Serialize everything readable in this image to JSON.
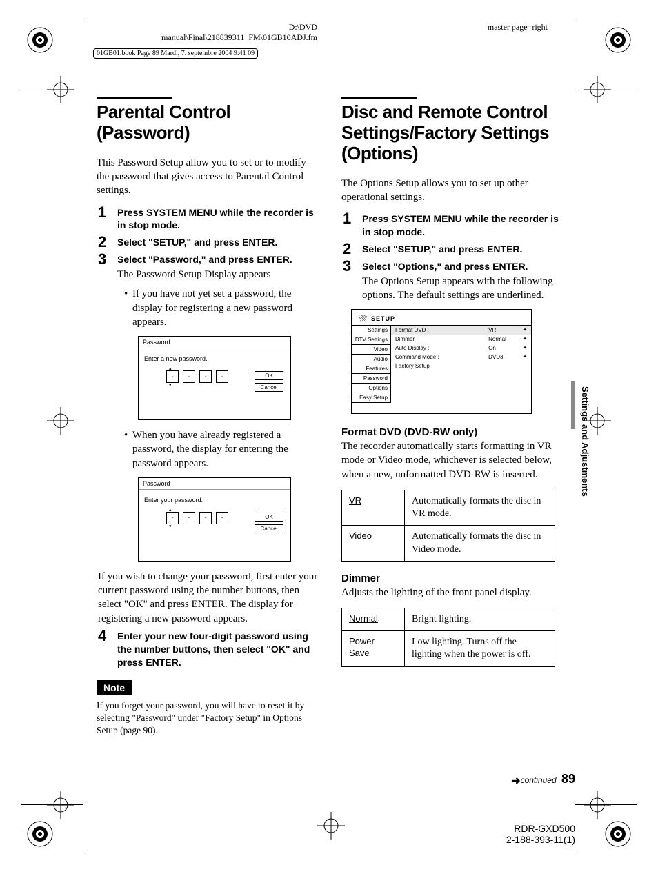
{
  "meta": {
    "path1": "D:\\DVD",
    "path2": "manual\\Final\\218839311_FM\\01GB10ADJ.fm",
    "master": "master page=right",
    "book": "01GB01.book  Page 89  Mardi, 7. septembre 2004  9:41 09"
  },
  "side_title": "Settings and Adjustments",
  "left": {
    "title": "Parental Control (Password)",
    "intro": "This Password Setup allow you to set or to modify the password that gives access to Parental Control settings.",
    "steps": [
      {
        "num": "1",
        "bold": "Press SYSTEM MENU while the recorder is in stop mode."
      },
      {
        "num": "2",
        "bold": "Select \"SETUP,\" and press ENTER."
      },
      {
        "num": "3",
        "bold": "Select \"Password,\" and press ENTER.",
        "body": "The Password Setup Display appears"
      },
      {
        "num": "4",
        "bold": "Enter your new four-digit password using the number buttons, then select \"OK\" and press ENTER."
      }
    ],
    "bullets": [
      "If you have not yet set a password, the display for registering a new password appears.",
      "When you have already registered a password, the display for entering the password appears."
    ],
    "diagram1": {
      "title": "Password",
      "prompt": "Enter a new password.",
      "ok": "OK",
      "cancel": "Cancel"
    },
    "diagram2": {
      "title": "Password",
      "prompt": "Enter your password.",
      "ok": "OK",
      "cancel": "Cancel"
    },
    "after_diagram2": "If you wish to change your password, first enter your current password using the number buttons, then select \"OK\" and press ENTER. The display for registering a new password appears.",
    "note_label": "Note",
    "note_text": "If you forget your password, you will have to reset it by selecting \"Password\" under \"Factory Setup\" in Options Setup (page 90)."
  },
  "right": {
    "title": "Disc and Remote Control Settings/Factory Settings (Options)",
    "intro": "The Options Setup allows you to set up other operational settings.",
    "steps": [
      {
        "num": "1",
        "bold": "Press SYSTEM MENU while the recorder is in stop mode."
      },
      {
        "num": "2",
        "bold": "Select \"SETUP,\" and press ENTER."
      },
      {
        "num": "3",
        "bold": "Select \"Options,\" and press ENTER.",
        "body": "The Options Setup appears with the following options. The default settings are underlined."
      }
    ],
    "setup": {
      "title": "SETUP",
      "sidebar": [
        "Settings",
        "DTV Settings",
        "Video",
        "Audio",
        "Features",
        "Password",
        "Options",
        "Easy Setup"
      ],
      "rows": [
        {
          "label": "Format DVD :",
          "value": "VR"
        },
        {
          "label": "Dimmer :",
          "value": "Normal"
        },
        {
          "label": "Auto Display :",
          "value": "On"
        },
        {
          "label": "Command Mode :",
          "value": "DVD3"
        },
        {
          "label": "Factory Setup",
          "value": ""
        }
      ]
    },
    "format": {
      "heading": "Format DVD (DVD-RW only)",
      "desc": "The recorder automatically starts formatting in VR mode or Video mode, whichever is selected below, when a new, unformatted DVD-RW is inserted.",
      "table": [
        {
          "key": "VR",
          "underline": true,
          "val": "Automatically formats the disc in VR mode."
        },
        {
          "key": "Video",
          "underline": false,
          "val": "Automatically formats the disc in Video mode."
        }
      ]
    },
    "dimmer": {
      "heading": "Dimmer",
      "desc": "Adjusts the lighting of the front panel display.",
      "table": [
        {
          "key": "Normal",
          "underline": true,
          "val": "Bright lighting."
        },
        {
          "key": "Power Save",
          "underline": false,
          "val": "Low lighting. Turns off the lighting when the power is off."
        }
      ]
    }
  },
  "footer": {
    "continued": "continued",
    "page": "89",
    "model": "RDR-GXD500",
    "code": "2-188-393-11(1)"
  }
}
